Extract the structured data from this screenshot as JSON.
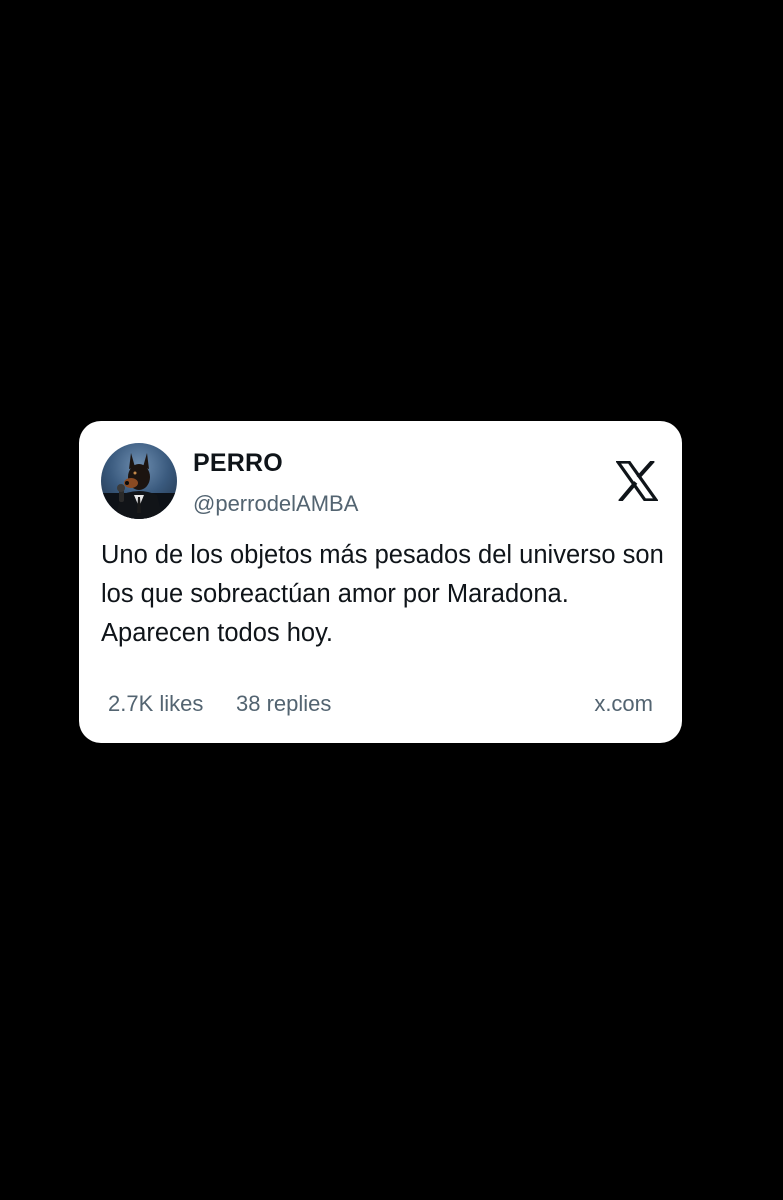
{
  "tweet": {
    "display_name": "PERRO",
    "handle": "@perrodelAMBA",
    "text": "Uno de los objetos más pesados del universo son los que sobreactúan amor por Maradona. Aparecen todos hoy.",
    "likes": "2.7K likes",
    "replies": "38 replies",
    "source": "x.com",
    "avatar_icon": "doberman-in-suit-avatar",
    "brand_icon": "x-logo-icon"
  },
  "colors": {
    "background": "#000000",
    "card": "#ffffff",
    "primary_text": "#0f1419",
    "secondary_text": "#536471"
  }
}
